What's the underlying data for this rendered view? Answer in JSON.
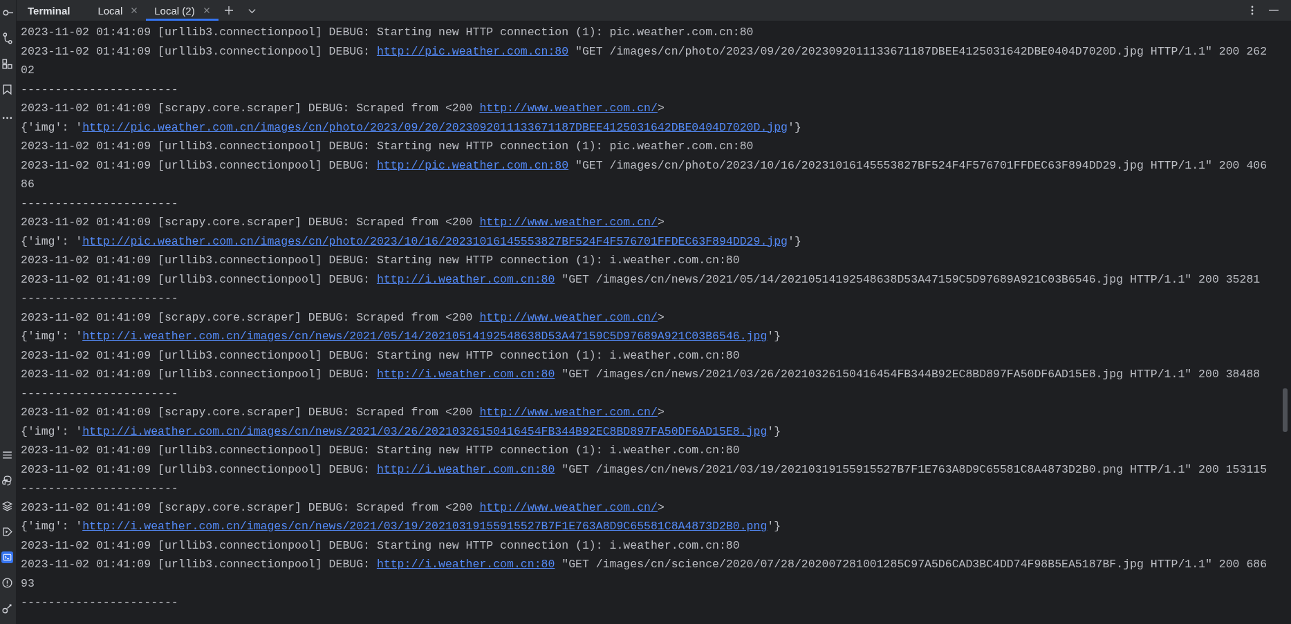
{
  "panel": {
    "title": "Terminal"
  },
  "tabs": [
    {
      "label": "Local",
      "selected": false
    },
    {
      "label": "Local (2)",
      "selected": true
    }
  ],
  "lines": [
    {
      "segments": [
        {
          "kind": "text",
          "text": "2023-11-02 01:41:09 [urllib3.connectionpool] DEBUG: Starting new HTTP connection (1): pic.weather.com.cn:80"
        }
      ]
    },
    {
      "segments": [
        {
          "kind": "text",
          "text": "2023-11-02 01:41:09 [urllib3.connectionpool] DEBUG: "
        },
        {
          "kind": "link",
          "text": "http://pic.weather.com.cn:80"
        },
        {
          "kind": "text",
          "text": " \"GET /images/cn/photo/2023/09/20/2023092011133671187DBEE4125031642DBE0404D7020D.jpg HTTP/1.1\" 200 262"
        }
      ]
    },
    {
      "segments": [
        {
          "kind": "text",
          "text": "02"
        }
      ]
    },
    {
      "segments": [
        {
          "kind": "text",
          "text": "-----------------------"
        }
      ]
    },
    {
      "segments": [
        {
          "kind": "text",
          "text": "2023-11-02 01:41:09 [scrapy.core.scraper] DEBUG: Scraped from <200 "
        },
        {
          "kind": "link",
          "text": "http://www.weather.com.cn/"
        },
        {
          "kind": "text",
          "text": ">"
        }
      ]
    },
    {
      "segments": [
        {
          "kind": "text",
          "text": "{'img': '"
        },
        {
          "kind": "link",
          "text": "http://pic.weather.com.cn/images/cn/photo/2023/09/20/2023092011133671187DBEE4125031642DBE0404D7020D.jpg"
        },
        {
          "kind": "text",
          "text": "'}"
        }
      ]
    },
    {
      "segments": [
        {
          "kind": "text",
          "text": "2023-11-02 01:41:09 [urllib3.connectionpool] DEBUG: Starting new HTTP connection (1): pic.weather.com.cn:80"
        }
      ]
    },
    {
      "segments": [
        {
          "kind": "text",
          "text": "2023-11-02 01:41:09 [urllib3.connectionpool] DEBUG: "
        },
        {
          "kind": "link",
          "text": "http://pic.weather.com.cn:80"
        },
        {
          "kind": "text",
          "text": " \"GET /images/cn/photo/2023/10/16/20231016145553827BF524F4F576701FFDEC63F894DD29.jpg HTTP/1.1\" 200 406"
        }
      ]
    },
    {
      "segments": [
        {
          "kind": "text",
          "text": "86"
        }
      ]
    },
    {
      "segments": [
        {
          "kind": "text",
          "text": "-----------------------"
        }
      ]
    },
    {
      "segments": [
        {
          "kind": "text",
          "text": "2023-11-02 01:41:09 [scrapy.core.scraper] DEBUG: Scraped from <200 "
        },
        {
          "kind": "link",
          "text": "http://www.weather.com.cn/"
        },
        {
          "kind": "text",
          "text": ">"
        }
      ]
    },
    {
      "segments": [
        {
          "kind": "text",
          "text": "{'img': '"
        },
        {
          "kind": "link",
          "text": "http://pic.weather.com.cn/images/cn/photo/2023/10/16/20231016145553827BF524F4F576701FFDEC63F894DD29.jpg"
        },
        {
          "kind": "text",
          "text": "'}"
        }
      ]
    },
    {
      "segments": [
        {
          "kind": "text",
          "text": "2023-11-02 01:41:09 [urllib3.connectionpool] DEBUG: Starting new HTTP connection (1): i.weather.com.cn:80"
        }
      ]
    },
    {
      "segments": [
        {
          "kind": "text",
          "text": "2023-11-02 01:41:09 [urllib3.connectionpool] DEBUG: "
        },
        {
          "kind": "link",
          "text": "http://i.weather.com.cn:80"
        },
        {
          "kind": "text",
          "text": " \"GET /images/cn/news/2021/05/14/20210514192548638D53A47159C5D97689A921C03B6546.jpg HTTP/1.1\" 200 35281"
        }
      ]
    },
    {
      "segments": [
        {
          "kind": "text",
          "text": "-----------------------"
        }
      ]
    },
    {
      "segments": [
        {
          "kind": "text",
          "text": "2023-11-02 01:41:09 [scrapy.core.scraper] DEBUG: Scraped from <200 "
        },
        {
          "kind": "link",
          "text": "http://www.weather.com.cn/"
        },
        {
          "kind": "text",
          "text": ">"
        }
      ]
    },
    {
      "segments": [
        {
          "kind": "text",
          "text": "{'img': '"
        },
        {
          "kind": "link",
          "text": "http://i.weather.com.cn/images/cn/news/2021/05/14/20210514192548638D53A47159C5D97689A921C03B6546.jpg"
        },
        {
          "kind": "text",
          "text": "'}"
        }
      ]
    },
    {
      "segments": [
        {
          "kind": "text",
          "text": "2023-11-02 01:41:09 [urllib3.connectionpool] DEBUG: Starting new HTTP connection (1): i.weather.com.cn:80"
        }
      ]
    },
    {
      "segments": [
        {
          "kind": "text",
          "text": "2023-11-02 01:41:09 [urllib3.connectionpool] DEBUG: "
        },
        {
          "kind": "link",
          "text": "http://i.weather.com.cn:80"
        },
        {
          "kind": "text",
          "text": " \"GET /images/cn/news/2021/03/26/20210326150416454FB344B92EC8BD897FA50DF6AD15E8.jpg HTTP/1.1\" 200 38488"
        }
      ]
    },
    {
      "segments": [
        {
          "kind": "text",
          "text": "-----------------------"
        }
      ]
    },
    {
      "segments": [
        {
          "kind": "text",
          "text": "2023-11-02 01:41:09 [scrapy.core.scraper] DEBUG: Scraped from <200 "
        },
        {
          "kind": "link",
          "text": "http://www.weather.com.cn/"
        },
        {
          "kind": "text",
          "text": ">"
        }
      ]
    },
    {
      "segments": [
        {
          "kind": "text",
          "text": "{'img': '"
        },
        {
          "kind": "link",
          "text": "http://i.weather.com.cn/images/cn/news/2021/03/26/20210326150416454FB344B92EC8BD897FA50DF6AD15E8.jpg"
        },
        {
          "kind": "text",
          "text": "'}"
        }
      ]
    },
    {
      "segments": [
        {
          "kind": "text",
          "text": "2023-11-02 01:41:09 [urllib3.connectionpool] DEBUG: Starting new HTTP connection (1): i.weather.com.cn:80"
        }
      ]
    },
    {
      "segments": [
        {
          "kind": "text",
          "text": "2023-11-02 01:41:09 [urllib3.connectionpool] DEBUG: "
        },
        {
          "kind": "link",
          "text": "http://i.weather.com.cn:80"
        },
        {
          "kind": "text",
          "text": " \"GET /images/cn/news/2021/03/19/20210319155915527B7F1E763A8D9C65581C8A4873D2B0.png HTTP/1.1\" 200 153115"
        }
      ]
    },
    {
      "segments": [
        {
          "kind": "text",
          "text": "-----------------------"
        }
      ]
    },
    {
      "segments": [
        {
          "kind": "text",
          "text": "2023-11-02 01:41:09 [scrapy.core.scraper] DEBUG: Scraped from <200 "
        },
        {
          "kind": "link",
          "text": "http://www.weather.com.cn/"
        },
        {
          "kind": "text",
          "text": ">"
        }
      ]
    },
    {
      "segments": [
        {
          "kind": "text",
          "text": "{'img': '"
        },
        {
          "kind": "link",
          "text": "http://i.weather.com.cn/images/cn/news/2021/03/19/20210319155915527B7F1E763A8D9C65581C8A4873D2B0.png"
        },
        {
          "kind": "text",
          "text": "'}"
        }
      ]
    },
    {
      "segments": [
        {
          "kind": "text",
          "text": "2023-11-02 01:41:09 [urllib3.connectionpool] DEBUG: Starting new HTTP connection (1): i.weather.com.cn:80"
        }
      ]
    },
    {
      "segments": [
        {
          "kind": "text",
          "text": "2023-11-02 01:41:09 [urllib3.connectionpool] DEBUG: "
        },
        {
          "kind": "link",
          "text": "http://i.weather.com.cn:80"
        },
        {
          "kind": "text",
          "text": " \"GET /images/cn/science/2020/07/28/202007281001285C97A5D6CAD3BC4DD74F98B5EA5187BF.jpg HTTP/1.1\" 200 686"
        }
      ]
    },
    {
      "segments": [
        {
          "kind": "text",
          "text": "93"
        }
      ]
    },
    {
      "segments": [
        {
          "kind": "text",
          "text": "-----------------------"
        }
      ]
    }
  ]
}
